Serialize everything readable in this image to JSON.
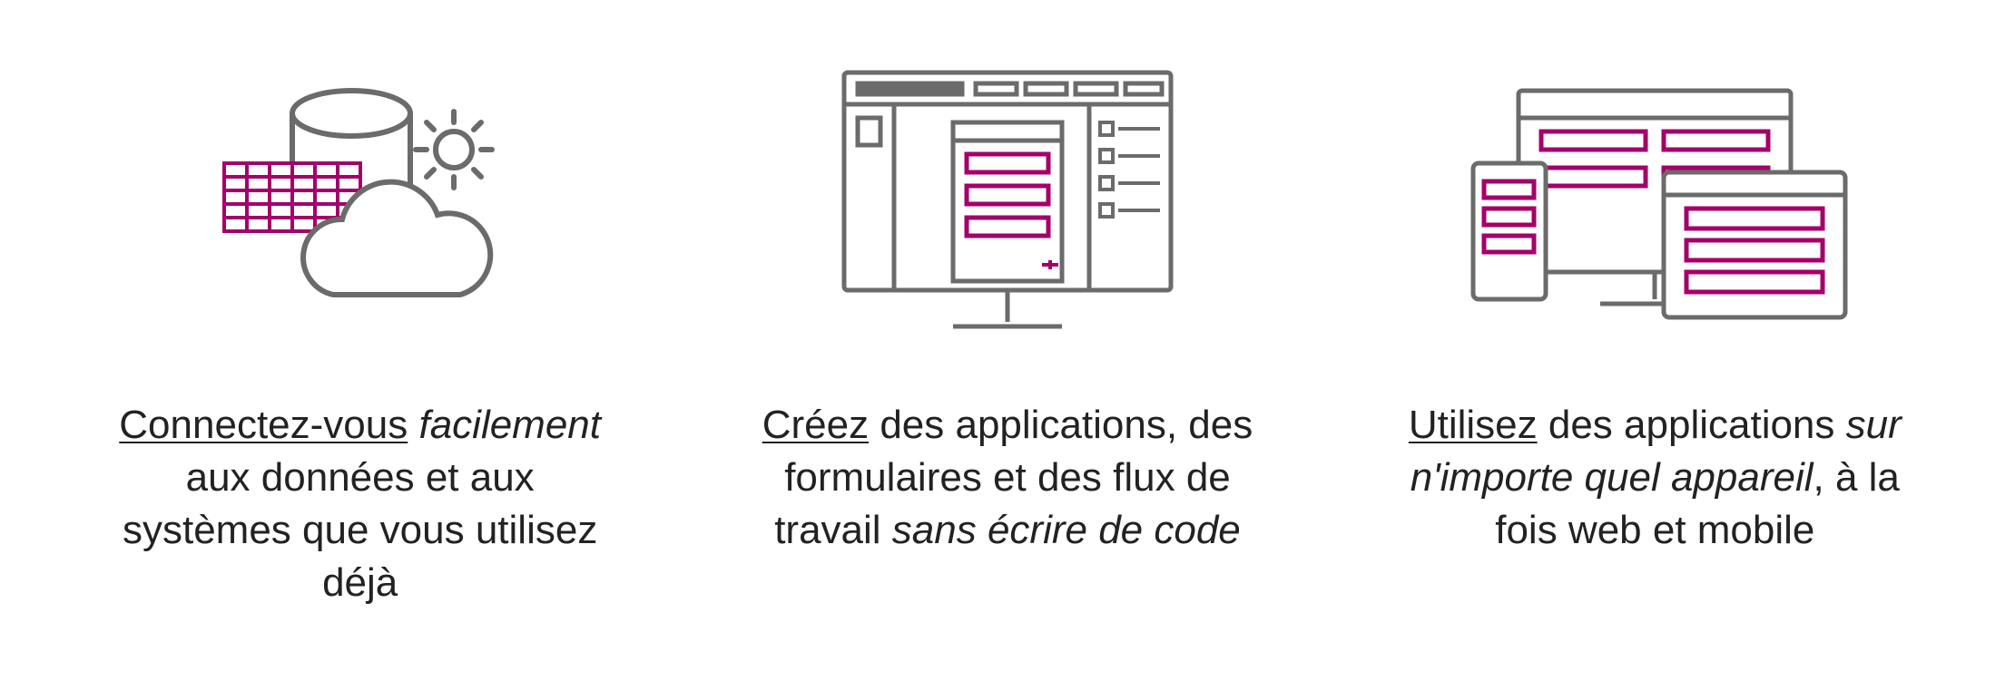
{
  "features": [
    {
      "icon": "data-cloud-icon",
      "lead": "Connectez-vous",
      "emph": "facilement",
      "tail": " aux données et aux systèmes que vous utilisez déjà"
    },
    {
      "icon": "app-builder-icon",
      "lead": "Créez",
      "mid": " des applications, des formulaires et des flux de travail ",
      "emph": "sans écrire de code"
    },
    {
      "icon": "devices-icon",
      "lead": "Utilisez",
      "mid": " des applications ",
      "emph": "sur n'importe quel appareil",
      "tail": ", à la fois web et mobile"
    }
  ],
  "colors": {
    "accent": "#a4006a",
    "stroke": "#6b6b6b"
  }
}
